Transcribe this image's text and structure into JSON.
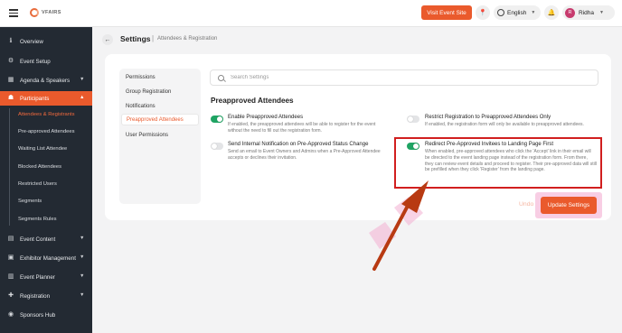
{
  "topbar": {
    "logo_text": "VFAIRS",
    "visit_button": "Visit Event Site",
    "language": "English",
    "user_initial": "R",
    "user_name": "Ridha"
  },
  "sidebar": {
    "items": [
      {
        "label": "Overview",
        "icon": "info-icon"
      },
      {
        "label": "Event Setup",
        "icon": "gear-icon"
      },
      {
        "label": "Agenda & Speakers",
        "icon": "calendar-icon"
      },
      {
        "label": "Participants",
        "icon": "people-icon"
      },
      {
        "label": "Event Content",
        "icon": "document-icon"
      },
      {
        "label": "Exhibitor Management",
        "icon": "store-icon"
      },
      {
        "label": "Event Planner",
        "icon": "planner-icon"
      },
      {
        "label": "Registration",
        "icon": "add-user-icon"
      },
      {
        "label": "Sponsors Hub",
        "icon": "sponsors-icon"
      }
    ],
    "participants_sub": [
      "Attendees & Registrants",
      "Pre-approved Attendees",
      "Waiting List Attendee",
      "Blocked Attendees",
      "Restricted Users",
      "Segments",
      "Segments Rules"
    ]
  },
  "header": {
    "title": "Settings",
    "subtitle": "Attendees & Registration"
  },
  "tabs": [
    "Permissions",
    "Group Registration",
    "Notifications",
    "Preapproved Attendees",
    "User Permissions"
  ],
  "search": {
    "placeholder": "Search Settings"
  },
  "section": {
    "title": "Preapproved Attendees",
    "options": [
      {
        "label": "Enable Preapproved Attendees",
        "desc": "If enabled, the preapproved attendees will be able to register for the event without the need to fill out the registration form.",
        "on": true
      },
      {
        "label": "Restrict Registration to Preapproved Attendees Only",
        "desc": "If enabled, the registration form will only be available to preapproved attendees.",
        "on": false
      },
      {
        "label": "Send Internal Notification on Pre-Approved Status Change",
        "desc": "Send an email to Event Owners and Admins when a Pre-Approved Attendee accepts or declines their invitation.",
        "on": false
      },
      {
        "label": "Redirect Pre-Approved Invitees to Landing Page First",
        "desc": "When enabled, pre-approved attendees who click the 'Accept' link in their email will be directed to the event landing page instead of the registration form. From there, they can review event details and proceed to register. Their pre-approved data will still be prefilled when they click 'Register' from the landing page.",
        "on": true
      }
    ]
  },
  "actions": {
    "undo": "Undo",
    "update": "Update Settings"
  },
  "colors": {
    "accent": "#ea5a2c",
    "sidebar_bg": "#232a33",
    "toggle_on": "#1fa463",
    "highlight": "#d11f1f",
    "arrow": "#b83a12"
  }
}
